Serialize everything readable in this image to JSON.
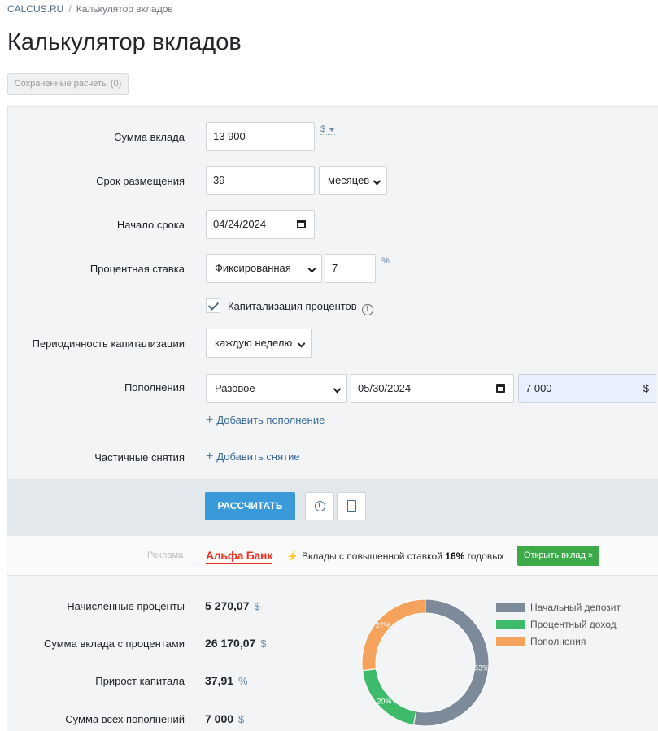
{
  "breadcrumb": {
    "home": "CALCUS.RU",
    "separator": "/",
    "current": "Калькулятор вкладов"
  },
  "page_title": "Калькулятор вкладов",
  "saved_button": "Сохраненные расчеты (0)",
  "form": {
    "deposit_amount": {
      "label": "Сумма вклада",
      "value": "13 900",
      "currency": "$"
    },
    "term": {
      "label": "Срок размещения",
      "value": "39",
      "unit": "месяцев"
    },
    "start_date": {
      "label": "Начало срока",
      "value": "04/24/2024"
    },
    "rate": {
      "label": "Процентная ставка",
      "type": "Фиксированная",
      "value": "7",
      "unit": "%"
    },
    "capitalization": {
      "label": "Капитализация процентов",
      "checked": true,
      "info": "i"
    },
    "cap_period": {
      "label": "Периодичность капитализации",
      "value": "каждую неделю"
    },
    "replenishments": {
      "label": "Пополнения",
      "type": "Разовое",
      "date": "05/30/2024",
      "amount": "7 000",
      "currency": "$",
      "add_label": "Добавить пополнение"
    },
    "withdrawals": {
      "label": "Частичные снятия",
      "add_label": "Добавить снятие"
    },
    "plus": "+"
  },
  "actions": {
    "calculate": "РАССЧИТАТЬ",
    "history_icon": "clock-icon",
    "export_icon": "document-icon"
  },
  "ad": {
    "label": "Реклама",
    "bank": "Альфа Банк",
    "text_pre": "Вклады с повышенной ставкой",
    "rate": "16%",
    "text_post": "годовых",
    "button": "Открыть вклад »",
    "bolt": "⚡"
  },
  "results": {
    "accrued_interest": {
      "label": "Начисленные проценты",
      "value": "5 270,07",
      "unit": "$"
    },
    "total_with_interest": {
      "label": "Сумма вклада с процентами",
      "value": "26 170,07",
      "unit": "$"
    },
    "capital_growth": {
      "label": "Прирост капитала",
      "value": "37,91",
      "unit": "%"
    },
    "total_replenishments": {
      "label": "Сумма всех пополнений",
      "value": "7 000",
      "unit": "$"
    }
  },
  "chart_data": {
    "type": "pie",
    "categories": [
      "Начальный депозит",
      "Процентный доход",
      "Пополнения"
    ],
    "values": [
      53,
      20,
      27
    ],
    "labels": [
      "53%",
      "20%",
      "27%"
    ],
    "colors": [
      "#7c8a99",
      "#3dbb6a",
      "#f5a35c"
    ],
    "donut": true,
    "legend_position": "right"
  }
}
